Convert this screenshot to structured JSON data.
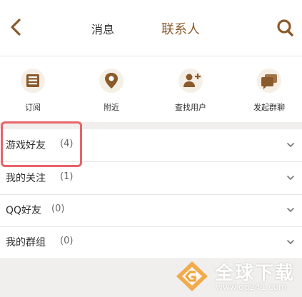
{
  "header": {
    "back_icon": "chevron-left-icon",
    "tab_messages": "消息",
    "tab_contacts": "联系人",
    "search_icon": "search-icon",
    "accent_color": "#8b5a2b"
  },
  "quick_actions": [
    {
      "label": "订阅",
      "icon": "subscribe-icon"
    },
    {
      "label": "附近",
      "icon": "location-pin-icon"
    },
    {
      "label": "查找用户",
      "icon": "add-user-icon"
    },
    {
      "label": "发起群聊",
      "icon": "group-chat-icon"
    }
  ],
  "groups": [
    {
      "name": "游戏好友",
      "count": "(4)",
      "highlighted": true
    },
    {
      "name": "我的关注",
      "count": "(1)"
    },
    {
      "name": "QQ好友",
      "count": "(0)"
    },
    {
      "name": "我的群组",
      "count": "(0)"
    }
  ],
  "highlight_color": "#e8636a",
  "watermark": {
    "title": "全球下载",
    "url": "www.qq241.com"
  }
}
